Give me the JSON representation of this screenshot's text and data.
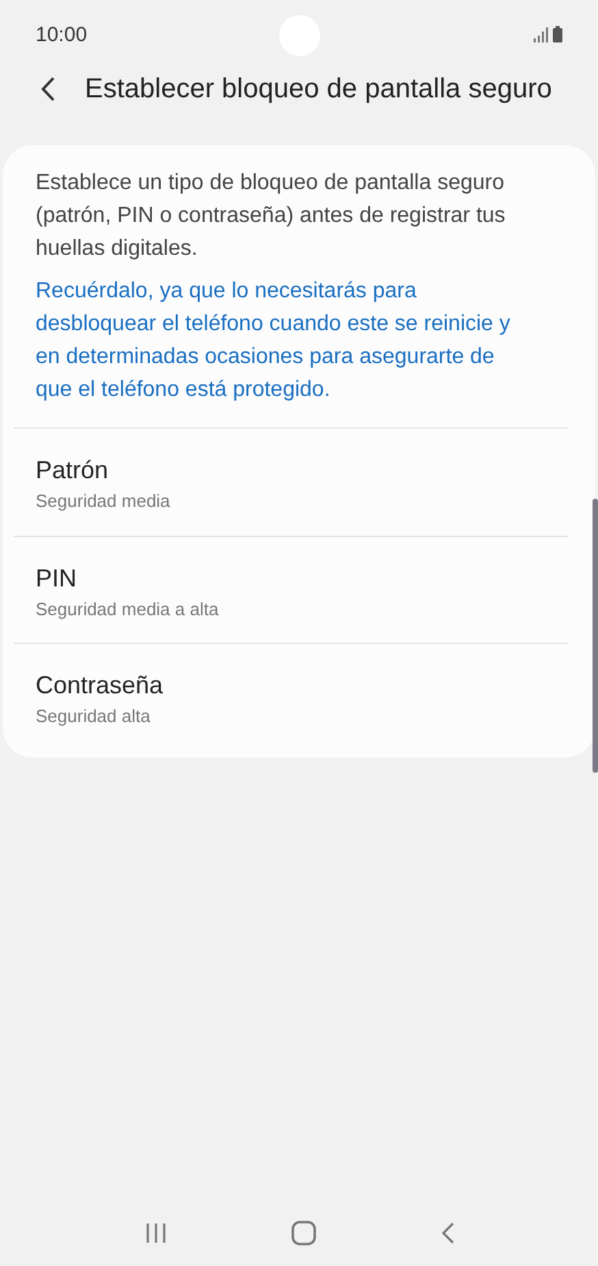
{
  "status_bar": {
    "time": "10:00"
  },
  "header": {
    "title": "Establecer bloqueo de pantalla seguro"
  },
  "intro": "Establece un tipo de bloqueo de pantalla seguro (patrón, PIN o contraseña) antes de registrar tus huellas digitales.",
  "note": "Recuérdalo, ya que lo necesitarás para desbloquear el teléfono cuando este se reinicie y en determinadas ocasiones para asegurarte de que el teléfono está protegido.",
  "options": [
    {
      "title": "Patrón",
      "subtitle": "Seguridad media"
    },
    {
      "title": "PIN",
      "subtitle": "Seguridad media a alta"
    },
    {
      "title": "Contraseña",
      "subtitle": "Seguridad alta"
    }
  ]
}
